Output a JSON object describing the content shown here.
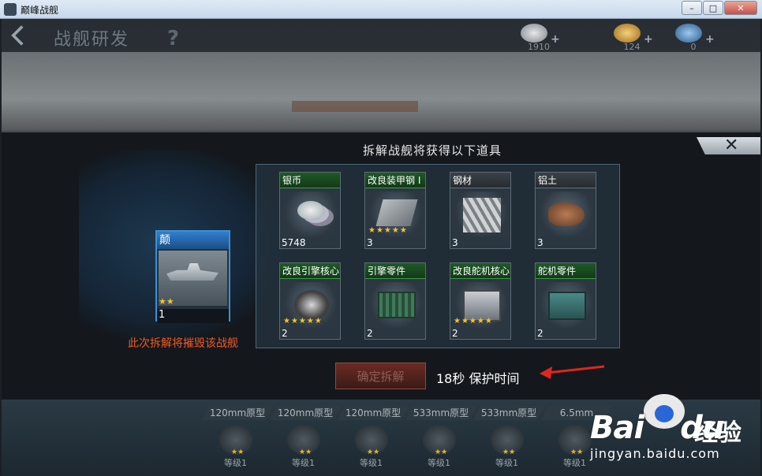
{
  "window": {
    "title": "巅峰战舰",
    "minimize": "–",
    "maximize": "□",
    "close": "✕"
  },
  "header": {
    "title": "战舰研发",
    "help": "?",
    "back_icon": "back-arrow-icon"
  },
  "resources": [
    {
      "name": "silver",
      "value": "1910",
      "color": "#b9bfc4"
    },
    {
      "name": "gold",
      "value": "124",
      "color": "#d7a137"
    },
    {
      "name": "gems",
      "value": "0",
      "color": "#4a8fd1"
    }
  ],
  "dialog": {
    "title": "拆解战舰将获得以下道具",
    "close": "✕",
    "warning": "此次拆解将摧毁该战舰",
    "confirm_label": "确定拆解",
    "protect_text": "18秒 保护时间",
    "accent": "#f05a25"
  },
  "ship": {
    "name": "颠",
    "stars": "★★",
    "count": "1"
  },
  "items": [
    {
      "name": "银币",
      "amount": "5748",
      "stars": "",
      "icon": "coins-icon",
      "green": true
    },
    {
      "name": "改良装甲钢 I",
      "amount": "3",
      "stars": "★★★★★",
      "icon": "armor-plate-icon",
      "green": true
    },
    {
      "name": "钢材",
      "amount": "3",
      "stars": "",
      "icon": "steel-beams-icon",
      "green": false
    },
    {
      "name": "铝土",
      "amount": "3",
      "stars": "",
      "icon": "bauxite-icon",
      "green": false
    },
    {
      "name": "改良引擎核心 I",
      "amount": "2",
      "stars": "★★★★★",
      "icon": "engine-core-icon",
      "green": true
    },
    {
      "name": "引擎零件",
      "amount": "2",
      "stars": "",
      "icon": "engine-parts-icon",
      "green": true
    },
    {
      "name": "改良舵机核心 I",
      "amount": "2",
      "stars": "★★★★★",
      "icon": "rudder-core-icon",
      "green": true
    },
    {
      "name": "舵机零件",
      "amount": "2",
      "stars": "",
      "icon": "rudder-parts-icon",
      "green": true
    }
  ],
  "slots": [
    {
      "label": "120mm原型",
      "stars": "★★",
      "level": "等级1"
    },
    {
      "label": "120mm原型",
      "stars": "★★",
      "level": "等级1"
    },
    {
      "label": "120mm原型",
      "stars": "★★",
      "level": "等级1"
    },
    {
      "label": "533mm原型",
      "stars": "★★",
      "level": "等级1"
    },
    {
      "label": "533mm原型",
      "stars": "★★",
      "level": "等级1"
    },
    {
      "label": "6.5mm",
      "stars": "★★",
      "level": "等级1"
    }
  ],
  "watermark": {
    "logo": "Bai",
    "logo2": "du",
    "cn": "经验",
    "url": "jingyan.baidu.com"
  }
}
